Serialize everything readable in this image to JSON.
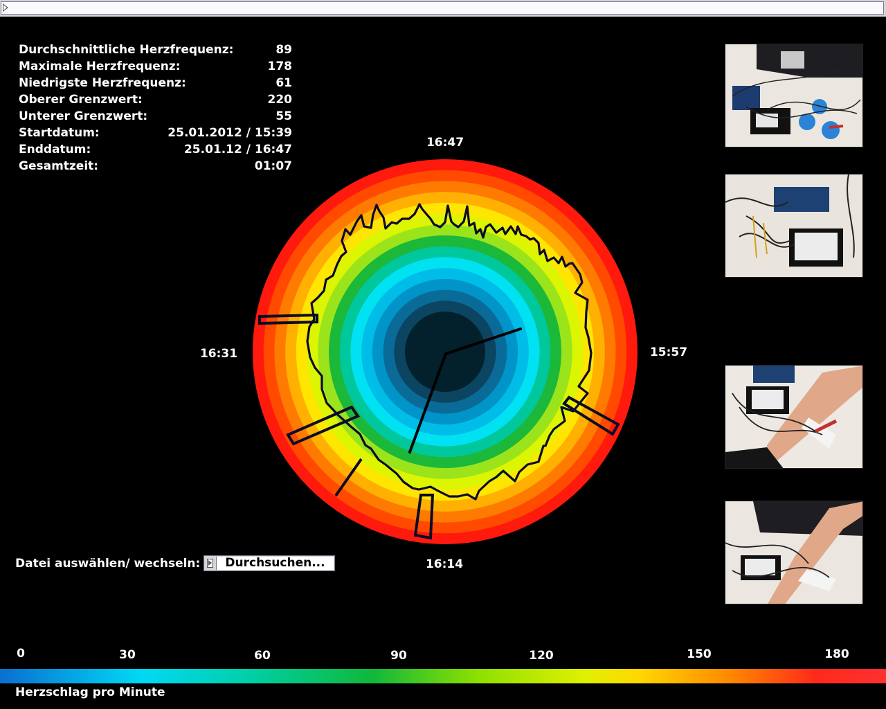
{
  "topbar": {
    "input_value": ""
  },
  "stats": [
    {
      "label": "Durchschnittliche Herzfrequenz:",
      "value": "89"
    },
    {
      "label": "Maximale Herzfrequenz:",
      "value": "178"
    },
    {
      "label": "Niedrigste Herzfrequenz:",
      "value": "61"
    },
    {
      "label": "Oberer Grenzwert:",
      "value": "220"
    },
    {
      "label": "Unterer Grenzwert:",
      "value": "55"
    },
    {
      "label": "Startdatum:",
      "value": "25.01.2012 / 15:39"
    },
    {
      "label": "Enddatum:",
      "value": "25.01.12 / 16:47"
    },
    {
      "label": "Gesamtzeit:",
      "value": "01:07"
    }
  ],
  "clock": {
    "top": "16:47",
    "right": "15:57",
    "bottom": "16:14",
    "left": "16:31",
    "ring_colors": [
      "#ff1a0d",
      "#ff4a00",
      "#ff7a00",
      "#ffb000",
      "#ffe600",
      "#dcf500",
      "#9be41b",
      "#1cb83a",
      "#00c79c",
      "#00e2f2",
      "#00bde8",
      "#0094c8",
      "#0a6b99",
      "#0b4561",
      "#02212c"
    ]
  },
  "file": {
    "label": "Datei auswählen/ wechseln:",
    "button": "Durchsuchen..."
  },
  "legend": {
    "title": "Herzschlag pro Minute",
    "ticks": [
      "0",
      "30",
      "60",
      "90",
      "120",
      "150",
      "180"
    ]
  },
  "photos": [
    "ecg-setup-photo-1",
    "ecg-setup-photo-2",
    "ecg-arm-photo-3",
    "ecg-arm-photo-4"
  ]
}
